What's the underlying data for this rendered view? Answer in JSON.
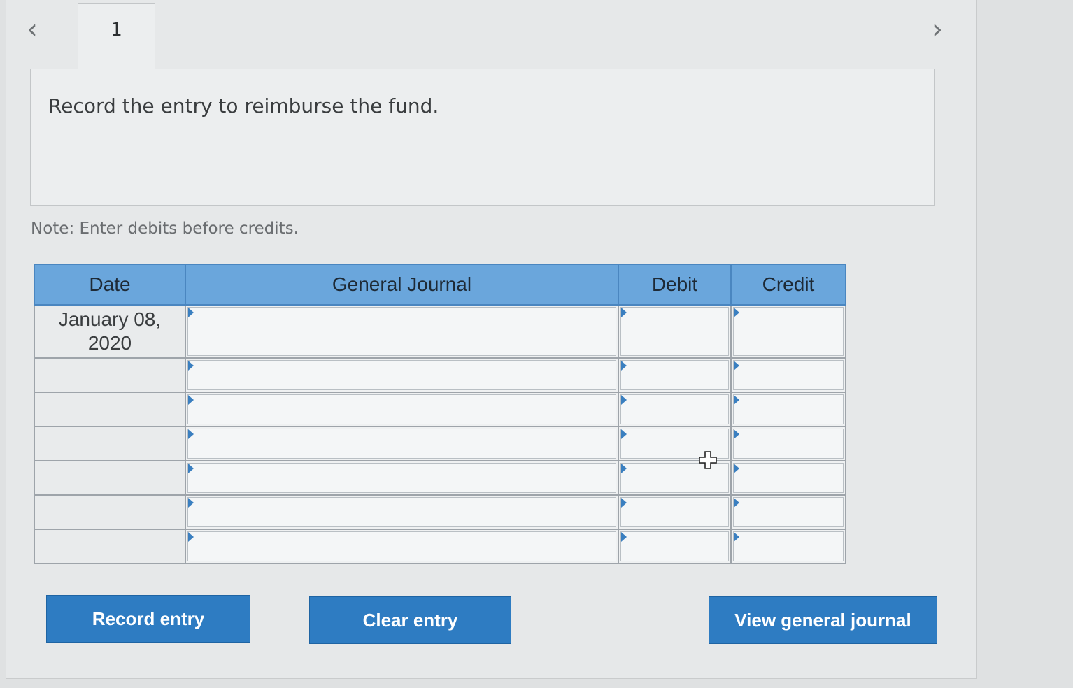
{
  "navigation": {
    "prev_icon": "chevron-left-icon",
    "prev_glyph": "‹",
    "next_icon": "chevron-right-icon",
    "next_glyph": "›"
  },
  "tab": {
    "label": "1"
  },
  "question": {
    "text": "Record the entry to reimburse the fund."
  },
  "note": "Note: Enter debits before credits.",
  "journal": {
    "headers": {
      "date": "Date",
      "general_journal": "General Journal",
      "debit": "Debit",
      "credit": "Credit"
    },
    "rows": [
      {
        "date_line1": "January 08,",
        "date_line2": "2020"
      },
      {
        "date_line1": "",
        "date_line2": ""
      },
      {
        "date_line1": "",
        "date_line2": ""
      },
      {
        "date_line1": "",
        "date_line2": ""
      },
      {
        "date_line1": "",
        "date_line2": ""
      },
      {
        "date_line1": "",
        "date_line2": ""
      },
      {
        "date_line1": "",
        "date_line2": ""
      }
    ]
  },
  "buttons": {
    "record": "Record entry",
    "clear": "Clear entry",
    "view": "View general journal"
  },
  "colors": {
    "header_bg": "#6aa6dc",
    "button_bg": "#2e7cc2",
    "input_marker": "#3a7fc0"
  }
}
